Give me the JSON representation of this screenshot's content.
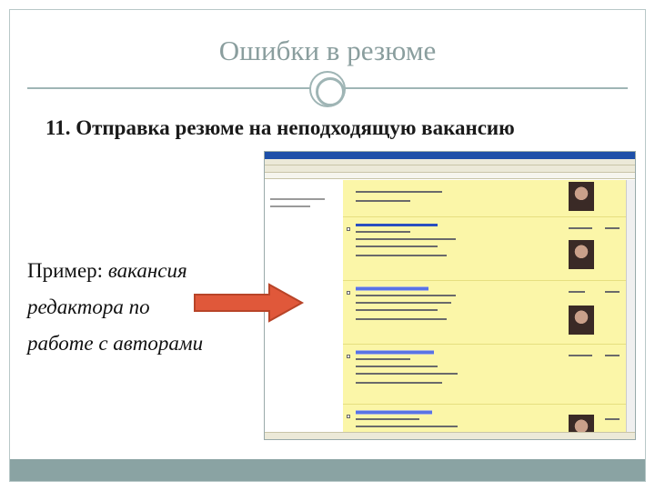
{
  "slide": {
    "title": "Ошибки в резюме",
    "heading": "11. Отправка резюме на неподходящую вакансию",
    "example_lead": "Пример: ",
    "example_italic_1": "вакансия",
    "example_italic_2": "редактора по",
    "example_italic_3": "работе с авторами"
  },
  "icons": {
    "ring": "ring-ornament-icon",
    "arrow": "right-arrow-icon"
  },
  "colors": {
    "accent": "#9fb5b5",
    "title_text": "#8a9e9e",
    "arrow_fill": "#e0583a",
    "bottom_bar": "#8aa3a3",
    "listing_bg": "#fbf6a8"
  }
}
